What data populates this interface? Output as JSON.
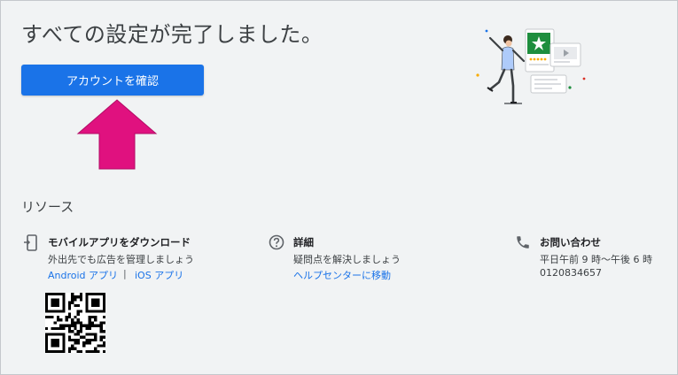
{
  "headline": "すべての設定が完了しました。",
  "primary_button": {
    "label": "アカウントを確認"
  },
  "resources": {
    "heading": "リソース",
    "mobile": {
      "title": "モバイルアプリをダウンロード",
      "description": "外出先でも広告を管理しましょう",
      "android_link": "Android アプリ",
      "separator": "|",
      "ios_link": "iOS アプリ"
    },
    "details": {
      "title": "詳細",
      "description": "疑問点を解決しましょう",
      "link": "ヘルプセンターに移動"
    },
    "contact": {
      "title": "お問い合わせ",
      "hours": "平日午前 9 時～午後 6 時",
      "phone": "0120834657"
    }
  },
  "colors": {
    "accent": "#1a73e8",
    "background": "#f1f3f4",
    "annotation_arrow": "#e0117f"
  },
  "icons": [
    "phone-app-icon",
    "help-circle-icon",
    "phone-icon",
    "qr-code",
    "star-badge-icon"
  ]
}
